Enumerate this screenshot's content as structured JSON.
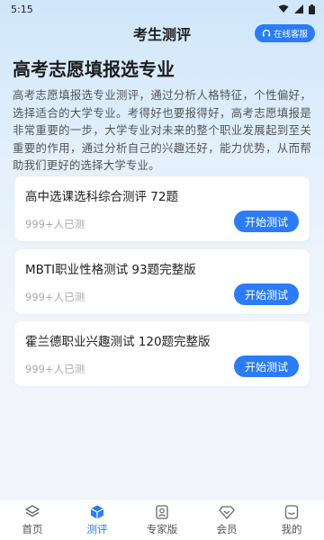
{
  "status": {
    "time": "5:15"
  },
  "header": {
    "title": "考生测评",
    "service_label": "在线客服"
  },
  "hero": {
    "title": "高考志愿填报选专业",
    "intro": "高考志愿填报选专业测评，通过分析人格特征，个性偏好，选择适合的大学专业。考得好也要报得好，高考志愿填报是非常重要的一步，大学专业对未来的整个职业发展起到至关重要的作用，通过分析自己的兴趣还好，能力优势，从而帮助我们更好的选择大学专业。"
  },
  "tests": [
    {
      "title": "高中选课选科综合测评 72题",
      "count": "999+人已测",
      "button": "开始测试"
    },
    {
      "title": "MBTI职业性格测试 93题完整版",
      "count": "999+人已测",
      "button": "开始测试"
    },
    {
      "title": "霍兰德职业兴趣测试 120题完整版",
      "count": "999+人已测",
      "button": "开始测试"
    }
  ],
  "tabbar": {
    "items": [
      {
        "label": "首页",
        "icon": "layers-icon"
      },
      {
        "label": "测评",
        "icon": "cube-icon"
      },
      {
        "label": "专家版",
        "icon": "expert-icon"
      },
      {
        "label": "会员",
        "icon": "diamond-icon"
      },
      {
        "label": "我的",
        "icon": "user-icon"
      }
    ],
    "active": "测评"
  },
  "colors": {
    "accent": "#2b7cf6",
    "active_tab": "#2b7cf6"
  }
}
